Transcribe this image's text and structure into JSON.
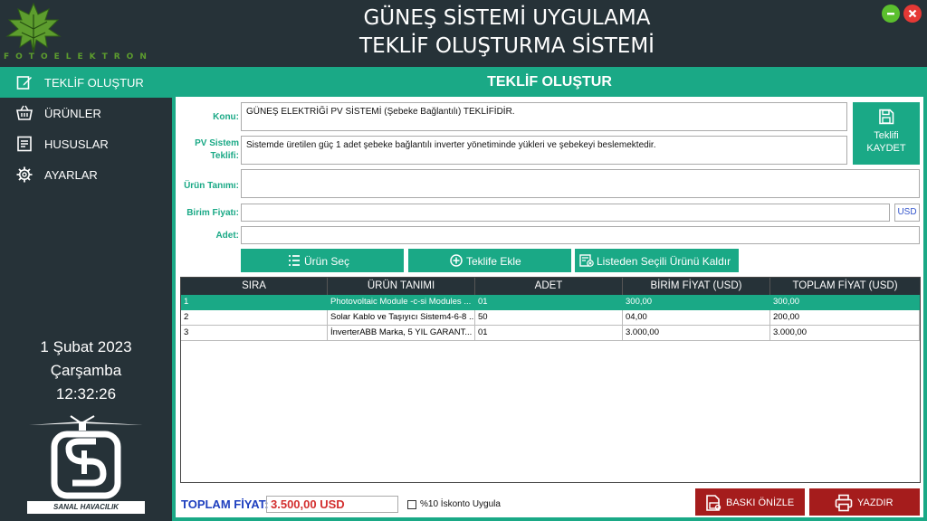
{
  "header": {
    "logo_text": "FOTOELEKTRON",
    "title_line1": "GÜNEŞ SİSTEMİ UYGULAMA",
    "title_line2": "TEKLİF OLUŞTURMA SİSTEMİ"
  },
  "sidebar": {
    "items": [
      {
        "label": "TEKLİF OLUŞTUR",
        "icon": "edit-icon"
      },
      {
        "label": "ÜRÜNLER",
        "icon": "basket-icon"
      },
      {
        "label": "HUSUSLAR",
        "icon": "document-icon"
      },
      {
        "label": "AYARLAR",
        "icon": "gear-icon"
      }
    ],
    "date": "1 Şubat 2023",
    "weekday": "Çarşamba",
    "time": "12:32:26",
    "brand_text": "SANAL HAVACILIK"
  },
  "main": {
    "title": "TEKLİF OLUŞTUR",
    "form": {
      "konu_label": "Konu:",
      "konu_value": "GÜNEŞ ELEKTRİĞİ PV SİSTEMİ (Şebeke Bağlantılı) TEKLİFİDİR.",
      "pv_label_1": "PV Sistem",
      "pv_label_2": "Teklifi:",
      "pv_value": "Sistemde üretilen güç 1 adet şebeke bağlantılı inverter yönetiminde yükleri ve şebekeyi beslemektedir.",
      "urun_label": "Ürün Tanımı:",
      "urun_value": "",
      "birim_label": "Birim Fiyatı:",
      "birim_value": "",
      "currency": "USD",
      "adet_label": "Adet:",
      "adet_value": ""
    },
    "save_button": {
      "line1": "Teklifi",
      "line2": "KAYDET"
    },
    "actions": {
      "select_product": "Ürün Seç",
      "add_to_offer": "Teklife Ekle",
      "remove_selected": "Listeden Seçili Ürünü Kaldır"
    },
    "table": {
      "columns": [
        "SIRA",
        "ÜRÜN TANIMI",
        "ADET",
        "BİRİM FİYAT (USD)",
        "TOPLAM FİYAT (USD)"
      ],
      "rows": [
        [
          "1",
          "Photovoltaic Module -c-si Modules ...",
          "01",
          "300,00",
          "300,00"
        ],
        [
          "2",
          "Solar Kablo ve Taşıyıcı Sistem4-6-8 ...",
          "50",
          "04,00",
          "200,00"
        ],
        [
          "3",
          "İnverterABB Marka, 5 YIL GARANT...",
          "01",
          "3.000,00",
          "3.000,00"
        ]
      ]
    },
    "footer": {
      "total_label": "TOPLAM FİYAT:",
      "total_value": "3.500,00 USD",
      "discount_label": "%10 İskonto Uygula",
      "preview_button": "BASKI ÖNİZLE",
      "print_button": "YAZDIR"
    }
  },
  "colors": {
    "accent": "#1aa986",
    "dark": "#263238",
    "danger": "#a51c1c",
    "total_label": "#1e3fbf"
  }
}
